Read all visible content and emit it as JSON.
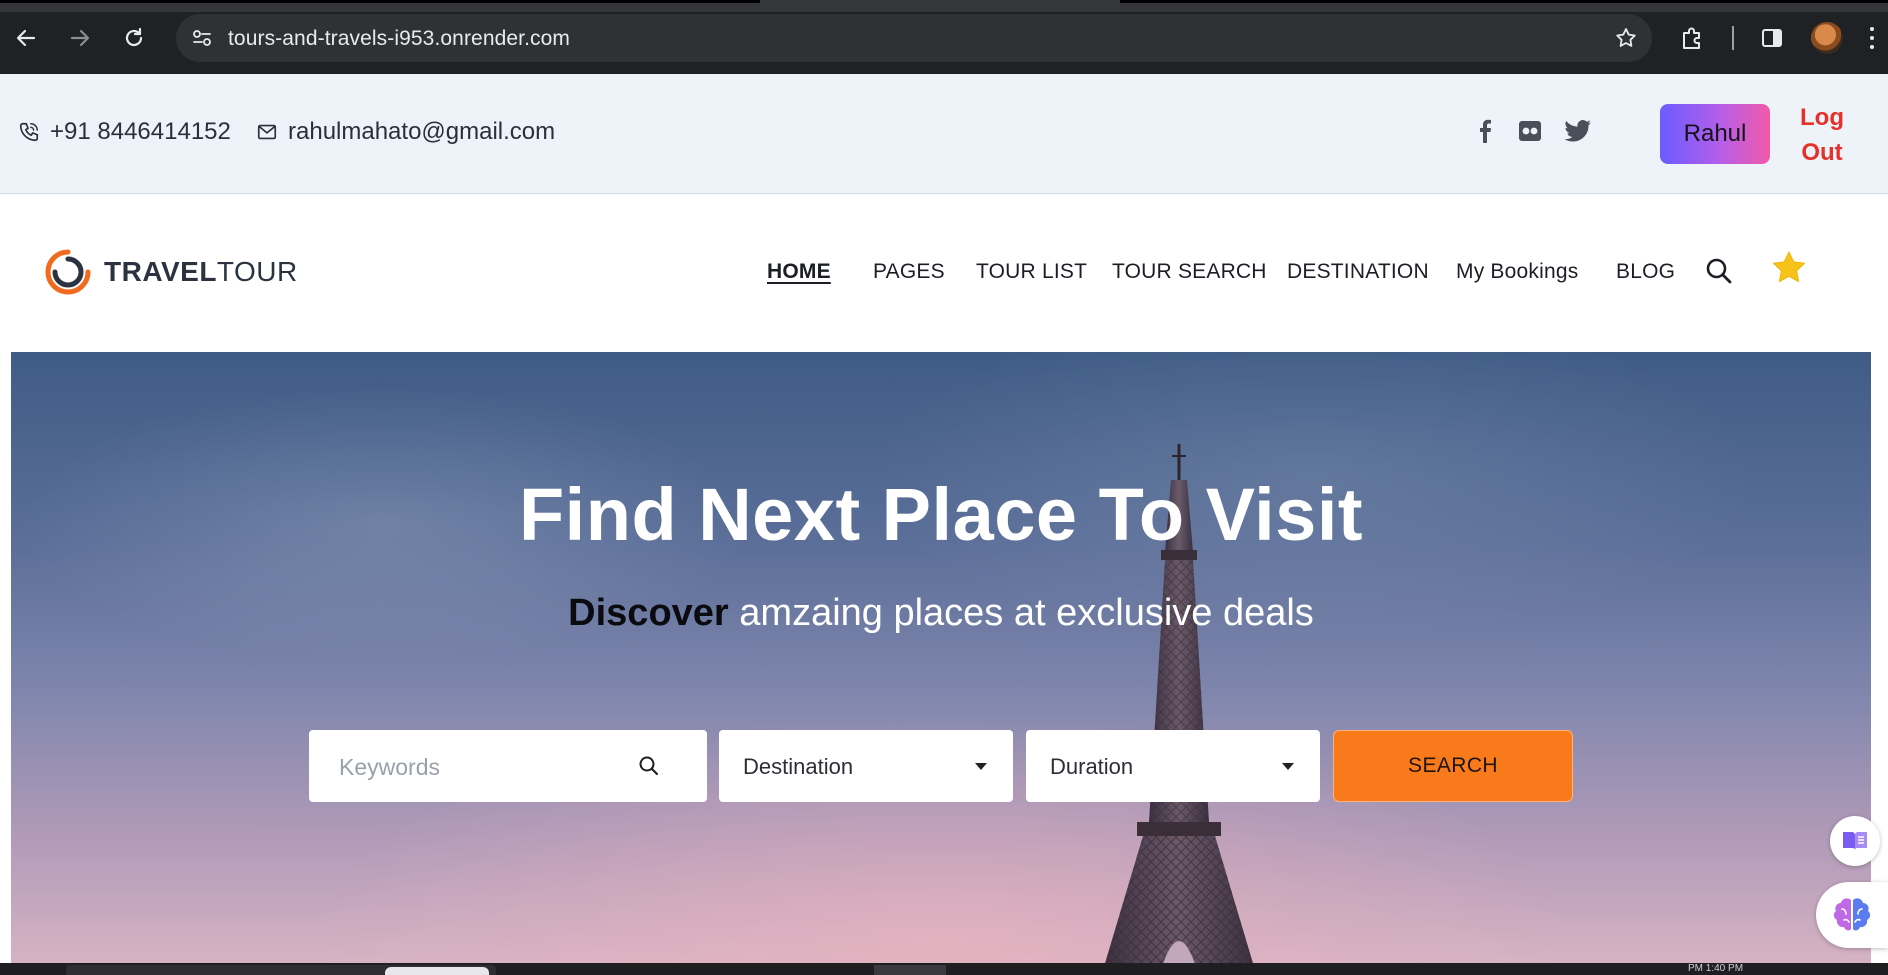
{
  "browser": {
    "url": "tours-and-travels-i953.onrender.com",
    "status_time": "PM  1:40 PM"
  },
  "topbar": {
    "phone": "+91 8446414152",
    "email": "rahulmahato@gmail.com",
    "social_icons": [
      "facebook-icon",
      "flickr-icon",
      "twitter-icon"
    ],
    "user_button": "Rahul",
    "logout_line1": "Log",
    "logout_line2": "Out",
    "colors": {
      "user_gradient_start": "#6a5cff",
      "user_gradient_end": "#f25aa8",
      "logout": "#e4322b"
    }
  },
  "header": {
    "logo_bold": "TRAVEL",
    "logo_light": "TOUR",
    "nav": {
      "home": "HOME",
      "pages": "PAGES",
      "tour_list": "TOUR LIST",
      "tour_search": "TOUR SEARCH",
      "destination": "DESTINATION",
      "bookings": "My Bookings",
      "blog": "BLOG"
    },
    "active_nav": "HOME"
  },
  "hero": {
    "title": "Find Next Place To Visit",
    "subtitle_emphasis": "Discover",
    "subtitle_rest": " amzaing places at exclusive deals",
    "search": {
      "keywords_placeholder": "Keywords",
      "destination_value": "Destination",
      "duration_value": "Duration",
      "button_label": "SEARCH"
    },
    "colors": {
      "search_button": "#f97a1a"
    }
  }
}
